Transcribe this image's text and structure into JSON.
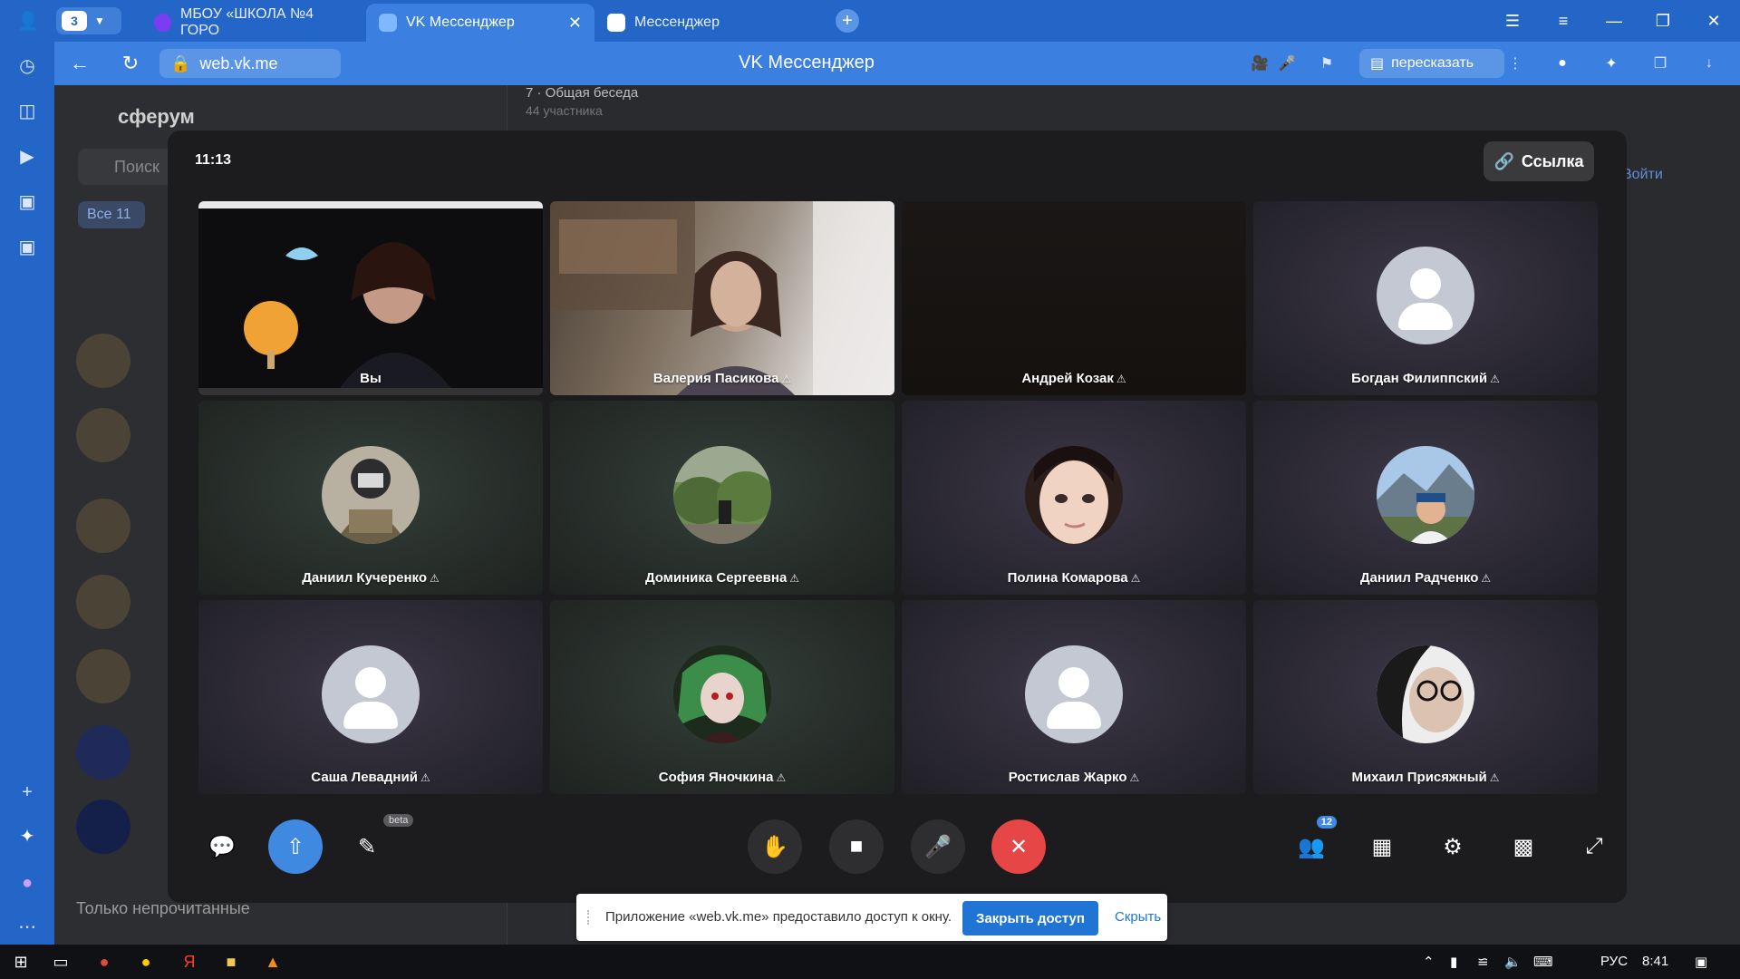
{
  "browser": {
    "tab_count": "3",
    "tabs": [
      {
        "title": "МБОУ «ШКОЛА №4 ГОРО"
      },
      {
        "title": "VK Мессенджер"
      },
      {
        "title": "Мессенджер"
      }
    ],
    "url": "web.vk.me",
    "page_title": "VK Мессенджер",
    "retell_label": "пересказать"
  },
  "background_page": {
    "logo": "сферум",
    "search_placeholder": "Поиск",
    "filter_chip": "Все",
    "filter_count": "11",
    "chat_header_title": "7 · Общая беседа",
    "chat_header_sub": "44 участника",
    "login_label": "Войти",
    "unread_only_label": "Только непрочитанные"
  },
  "call": {
    "time": "11:13",
    "link_label": "Ссылка",
    "participants": [
      {
        "name": "Вы"
      },
      {
        "name": "Валерия Пасикова"
      },
      {
        "name": "Андрей Козак"
      },
      {
        "name": "Богдан Филиппский"
      },
      {
        "name": "Даниил Кучеренко"
      },
      {
        "name": "Доминика Сергеевна"
      },
      {
        "name": "Полина Комарова"
      },
      {
        "name": "Даниил Радченко"
      },
      {
        "name": "Саша Левадний"
      },
      {
        "name": "София Яночкина"
      },
      {
        "name": "Ростислав Жарко"
      },
      {
        "name": "Михаил Присяжный"
      }
    ],
    "toolbar": {
      "beta_label": "beta",
      "participants_badge": "12"
    }
  },
  "share_notice": {
    "text": "Приложение «web.vk.me» предоставило доступ к окну.",
    "close_access_label": "Закрыть доступ",
    "hide_label": "Скрыть"
  },
  "taskbar": {
    "language": "РУС",
    "clock": "8:41"
  },
  "colors": {
    "accent_blue": "#2466c8",
    "call_bg": "#1c1c1e",
    "end_call_red": "#e64646",
    "share_button_blue": "#1f74d4"
  }
}
